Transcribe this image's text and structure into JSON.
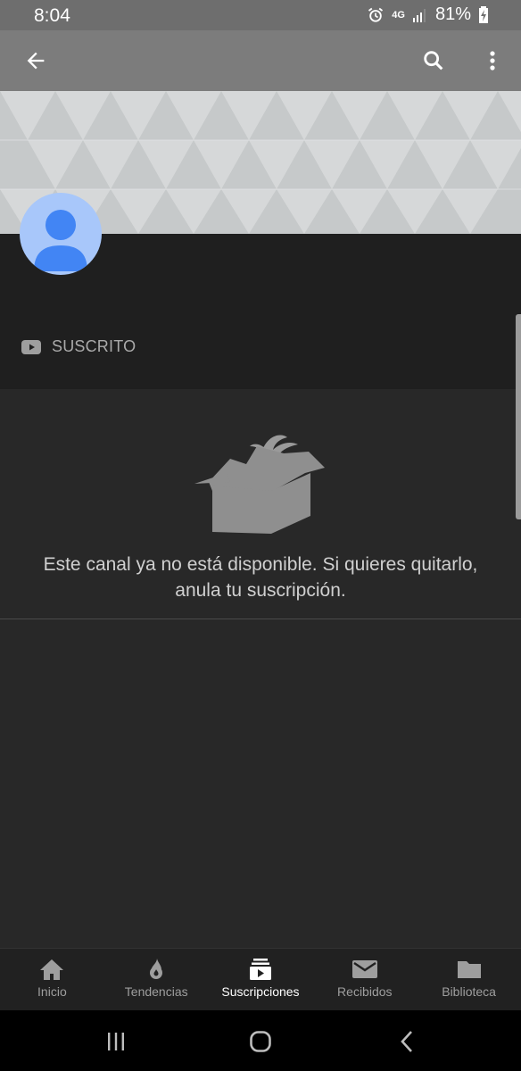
{
  "status_bar": {
    "time": "8:04",
    "network": "4G",
    "battery": "81%"
  },
  "colors": {
    "accent": "#4285f4",
    "avatar_bg": "#a8c7fa",
    "appbar": "#7c7c7c",
    "background": "#282828"
  },
  "app_bar": {
    "back_icon": "arrow-back-icon",
    "search_icon": "search-icon",
    "more_icon": "more-vert-icon"
  },
  "channel": {
    "subscribed_label": "SUSCRITO"
  },
  "empty_state": {
    "line1": "Este canal ya no está disponible. Si quieres quitarlo,",
    "line2": "anula tu suscripción."
  },
  "bottom_nav": {
    "items": [
      {
        "label": "Inicio",
        "icon": "home-icon"
      },
      {
        "label": "Tendencias",
        "icon": "flame-icon"
      },
      {
        "label": "Suscripciones",
        "icon": "subscriptions-icon",
        "active": true
      },
      {
        "label": "Recibidos",
        "icon": "mail-icon"
      },
      {
        "label": "Biblioteca",
        "icon": "folder-icon"
      }
    ]
  }
}
